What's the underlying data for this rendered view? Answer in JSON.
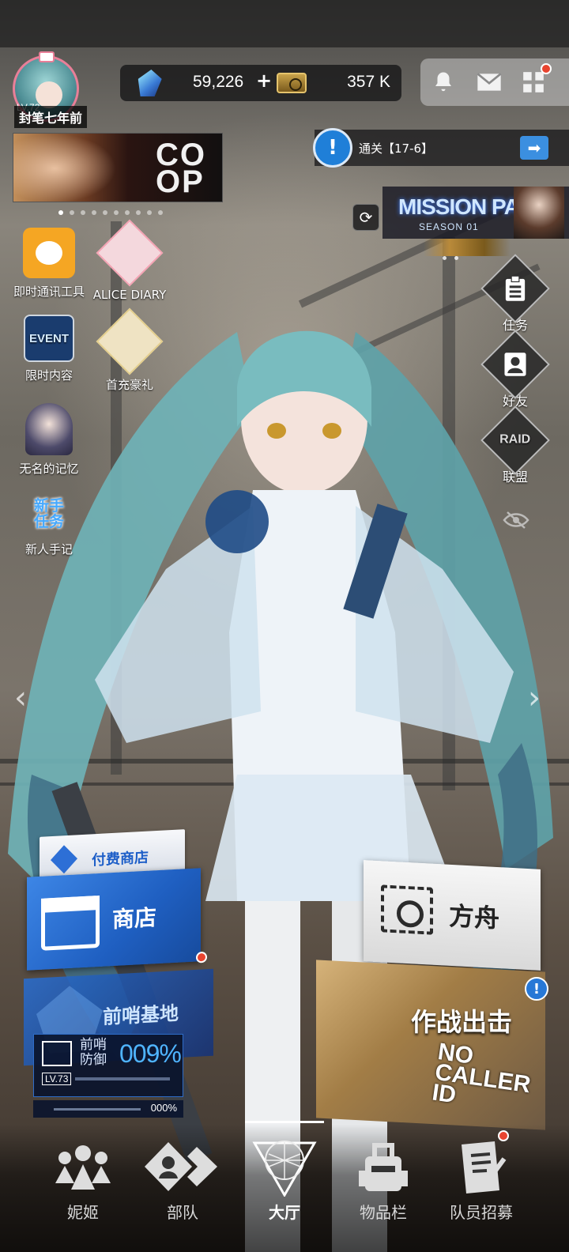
{
  "header": {
    "player_level": "LV.72",
    "player_name": "封笔七年前",
    "gems": "59,226",
    "gems_add": "+",
    "credits": "357 K",
    "icons": [
      "bell-icon",
      "mail-icon",
      "grid-menu-icon"
    ]
  },
  "banner": {
    "logo_top": "CO",
    "logo_bottom": "OP",
    "page_count": 10,
    "active_page": 0
  },
  "objective": {
    "icon": "!",
    "text": "通关【17-6】",
    "arrow": "➡"
  },
  "mission_pass": {
    "title": "MISSION PASS",
    "season": "SEASON 01"
  },
  "left_menu": [
    {
      "label": "即时通讯工具",
      "icon": "chat-bubble-icon"
    },
    {
      "label": "ALICE DIARY",
      "icon": "alice-diary-icon"
    },
    {
      "label": "限时内容",
      "icon": "event-icon",
      "icon_text": "EVENT"
    },
    {
      "label": "首充豪礼",
      "icon": "first-topup-gift-icon"
    },
    {
      "label": "无名的记忆",
      "icon": "nameless-memory-icon"
    },
    {
      "label": "新人手记",
      "icon": "newbie-mission-icon",
      "icon_text_1": "新手",
      "icon_text_2": "任务"
    }
  ],
  "right_menu": [
    {
      "label": "任务",
      "icon": "clipboard-icon"
    },
    {
      "label": "好友",
      "icon": "friend-icon"
    },
    {
      "label": "联盟",
      "icon": "union-icon",
      "icon_text": "RAID"
    }
  ],
  "shop": {
    "paid_shop_label": "付费商店",
    "shop_label": "商店"
  },
  "outpost": {
    "title": "前哨基地",
    "defense_label_1": "前哨",
    "defense_label_2": "防御",
    "defense_pct": "009%",
    "level": "LV.73",
    "sub_pct": "000%"
  },
  "ark": {
    "label": "方舟"
  },
  "battle": {
    "title": "作战出击",
    "event_line_1": "NO",
    "event_line_2": "CALLER",
    "event_line_3": "ID",
    "alert": "!"
  },
  "bottom_nav": [
    {
      "label": "妮姬",
      "icon": "nikke-icon"
    },
    {
      "label": "部队",
      "icon": "squad-icon"
    },
    {
      "label": "大厅",
      "icon": "lobby-icon",
      "active": true
    },
    {
      "label": "物品栏",
      "icon": "inventory-icon"
    },
    {
      "label": "队员招募",
      "icon": "recruit-icon"
    }
  ],
  "colors": {
    "accent_blue": "#2d6fd6",
    "notification_red": "#e8442f",
    "hair_teal": "#7fc6c8"
  }
}
